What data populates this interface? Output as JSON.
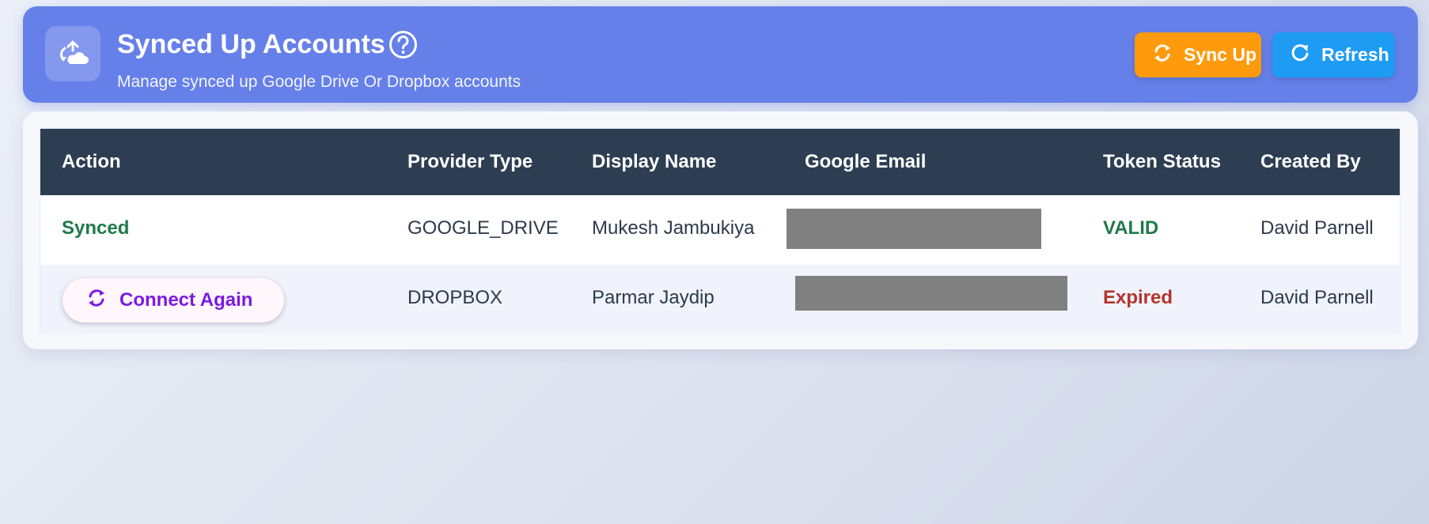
{
  "header": {
    "title": "Synced Up Accounts",
    "subtitle": "Manage synced up Google Drive Or Dropbox accounts",
    "icon": "cloud-sync-icon",
    "help_icon": "help-circle-icon",
    "buttons": {
      "sync_up": "Sync Up",
      "refresh": "Refresh"
    },
    "colors": {
      "background": "#6680e9",
      "sync_up": "#ff9a0c",
      "refresh": "#1e9bf3"
    }
  },
  "table": {
    "columns": [
      "Action",
      "Provider Type",
      "Display Name",
      "Google Email",
      "Token Status",
      "Created By"
    ],
    "rows": [
      {
        "action": "Synced",
        "provider_type": "GOOGLE_DRIVE",
        "display_name": "Mukesh Jambukiya",
        "google_email": "",
        "token_status": "VALID",
        "created_by": "David Parnell"
      },
      {
        "action": "Connect Again",
        "provider_type": "DROPBOX",
        "display_name": "Parmar Jaydip",
        "google_email": "",
        "token_status": "Expired",
        "created_by": "David Parnell"
      }
    ],
    "colors": {
      "header_bg": "#2d3e52",
      "valid": "#1f7a4a",
      "expired": "#b5332a",
      "connect": "#7a1be2"
    }
  }
}
